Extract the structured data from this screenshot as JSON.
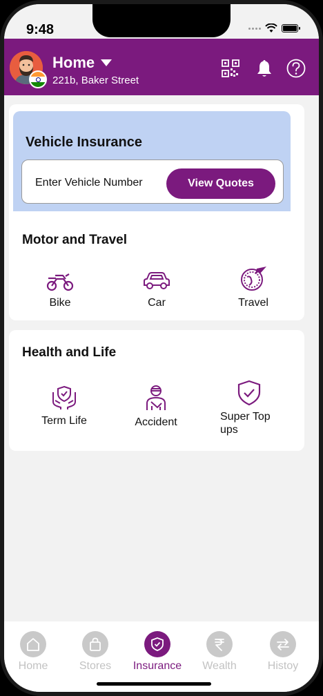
{
  "status_bar": {
    "time": "9:48"
  },
  "header": {
    "location_title": "Home",
    "location_subtitle": "221b, Baker Street"
  },
  "vehicle_insurance": {
    "title": "Vehicle Insurance",
    "input_placeholder": "Enter Vehicle Number",
    "button_label": "View Quotes"
  },
  "motor_travel": {
    "title": "Motor and Travel",
    "items": [
      {
        "label": "Bike",
        "icon": "motorbike-icon"
      },
      {
        "label": "Car",
        "icon": "car-icon"
      },
      {
        "label": "Travel",
        "icon": "travel-globe-icon"
      }
    ]
  },
  "health_life": {
    "title": "Health and Life",
    "items": [
      {
        "label": "Term Life",
        "icon": "hands-shield-icon"
      },
      {
        "label": "Accident",
        "icon": "injured-person-icon"
      },
      {
        "label": "Super Top ups",
        "icon": "shield-check-icon"
      }
    ]
  },
  "bottom_nav": {
    "items": [
      {
        "label": "Home",
        "icon": "house-icon"
      },
      {
        "label": "Stores",
        "icon": "shopping-bag-icon"
      },
      {
        "label": "Insurance",
        "icon": "shield-check-icon"
      },
      {
        "label": "Wealth",
        "icon": "rupee-icon"
      },
      {
        "label": "Histoy",
        "icon": "swap-arrows-icon"
      }
    ],
    "active": "Insurance"
  },
  "colors": {
    "brand": "#7b1a7e",
    "vehicle_panel": "#bfd2f3",
    "background": "#f2f2f2",
    "nav_inactive": "#c9c9c9"
  }
}
